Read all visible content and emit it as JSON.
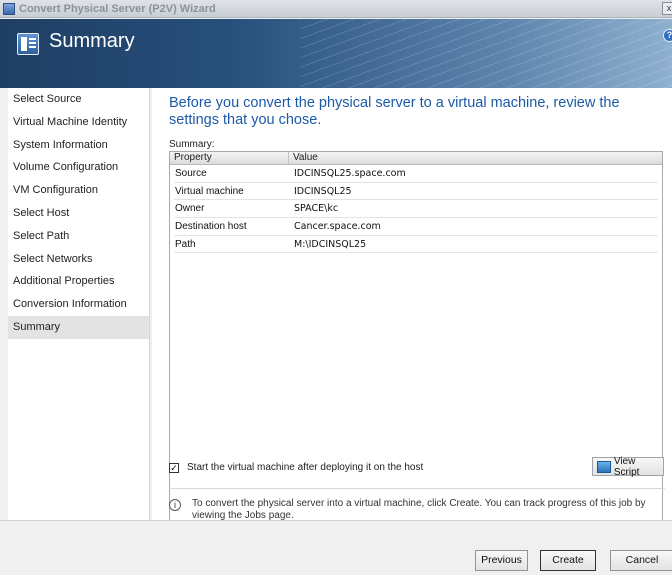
{
  "window": {
    "title": "Convert Physical Server (P2V) Wizard",
    "close_glyph": "x"
  },
  "banner": {
    "heading": "Summary",
    "help_glyph": "?"
  },
  "nav": {
    "items": [
      {
        "label": "Select Source"
      },
      {
        "label": "Virtual Machine Identity"
      },
      {
        "label": "System Information"
      },
      {
        "label": "Volume Configuration"
      },
      {
        "label": "VM Configuration"
      },
      {
        "label": "Select Host"
      },
      {
        "label": "Select Path"
      },
      {
        "label": "Select Networks"
      },
      {
        "label": "Additional Properties"
      },
      {
        "label": "Conversion Information"
      },
      {
        "label": "Summary"
      }
    ],
    "active_index": 10
  },
  "main": {
    "intro": "Before you convert the physical server to a virtual machine, review the settings that you chose.",
    "summary_label": "Summary:",
    "table": {
      "columns": [
        "Property",
        "Value"
      ],
      "rows": [
        [
          "Source",
          "IDCINSQL25.space.com"
        ],
        [
          "Virtual machine",
          "IDCINSQL25"
        ],
        [
          "Owner",
          "SPACE\\kc"
        ],
        [
          "Destination host",
          "Cancer.space.com"
        ],
        [
          "Path",
          "M:\\IDCINSQL25"
        ]
      ]
    },
    "start_vm_label": "Start the virtual machine after deploying it on the host",
    "start_vm_checked": true,
    "view_script_label": "View Script",
    "info_text": "To convert the physical server into a virtual machine, click Create.  You can track progress of this job by viewing the Jobs page."
  },
  "footer": {
    "previous_label": "Previous",
    "create_label": "Create",
    "cancel_label": "Cancel"
  },
  "icons": {
    "app": "p2v-wizard-icon",
    "summary": "summary-icon",
    "help": "help-icon",
    "info": "info-icon",
    "script": "script-icon"
  }
}
